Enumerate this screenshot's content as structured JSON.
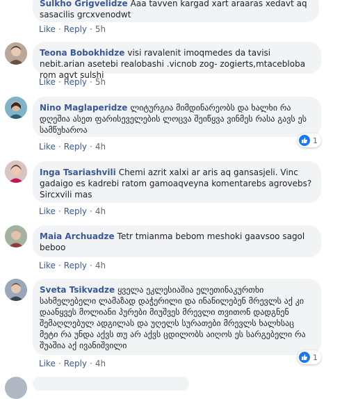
{
  "colors": {
    "link": "#385898",
    "bubble": "#f2f3f5",
    "meta": "#606770",
    "like_blue": "#1877f2"
  },
  "labels": {
    "like": "Like",
    "reply": "Reply",
    "sep": "·"
  },
  "comments": [
    {
      "author": "Sulkho Grigvelidze",
      "text": "Aaa tavven kargad xart araaras xedavt aq sasacilis grcxvenodwt",
      "time": "5h",
      "reactions": null,
      "avatar_icon": "user-avatar"
    },
    {
      "author": "Teona Bobokhidze",
      "text": "visi ravalenit imoqmedes da tavisi nebit.arian asetebi realobashi .vicnob zog- zogierts,mtacebloba rom aqvt sulshi",
      "time": "5h",
      "reactions": null,
      "avatar_icon": "user-avatar"
    },
    {
      "author": "Nino Maglaperidze",
      "text": "ლიტურგია მიმდინარეობს და ხალხი რა დღეშია ასეთ ფარისეველების ლოცვა შეიწყვა ვინმეს რასა გავს ეს სამწუხაროა",
      "time": "4h",
      "reactions": "1",
      "avatar_icon": "user-avatar"
    },
    {
      "author": "Inga Tsariashvili",
      "text": "Chemi azrit xalxi ar aris aq gansasjeli. Vinc gadaigo es kadrebi ratom gamoaqveyna komentarebs agrovebs? Sircxvili mas",
      "time": "4h",
      "reactions": null,
      "avatar_icon": "user-avatar"
    },
    {
      "author": "Maia Archuadze",
      "text": "Tetr tmianma bebom meshoki gaavsoo sagol beboo",
      "time": "4h",
      "reactions": null,
      "avatar_icon": "user-avatar"
    },
    {
      "author": "Sveta Tsikvadze",
      "text": "ყველა ეკლესიაშია ელეთინაკურთხი სახმელებელი ლამაზად დაჭერილი და ინანილებენ მრევლს აქ კი დაანყვეს მოლიანი პურები მიუშვეს მრევლი თვითონ დადგნენ შემაღლებულ ადგილას და უღელს სურათები მრევლს ხალხსაც მეტი რა უნდა აქვს თუ არ აქვს ცდილობს აიღოს ეს სარგებელი რა შუაშია აქ ივანიშვილი",
      "time": "4h",
      "reactions": "1",
      "avatar_icon": "user-avatar"
    }
  ]
}
